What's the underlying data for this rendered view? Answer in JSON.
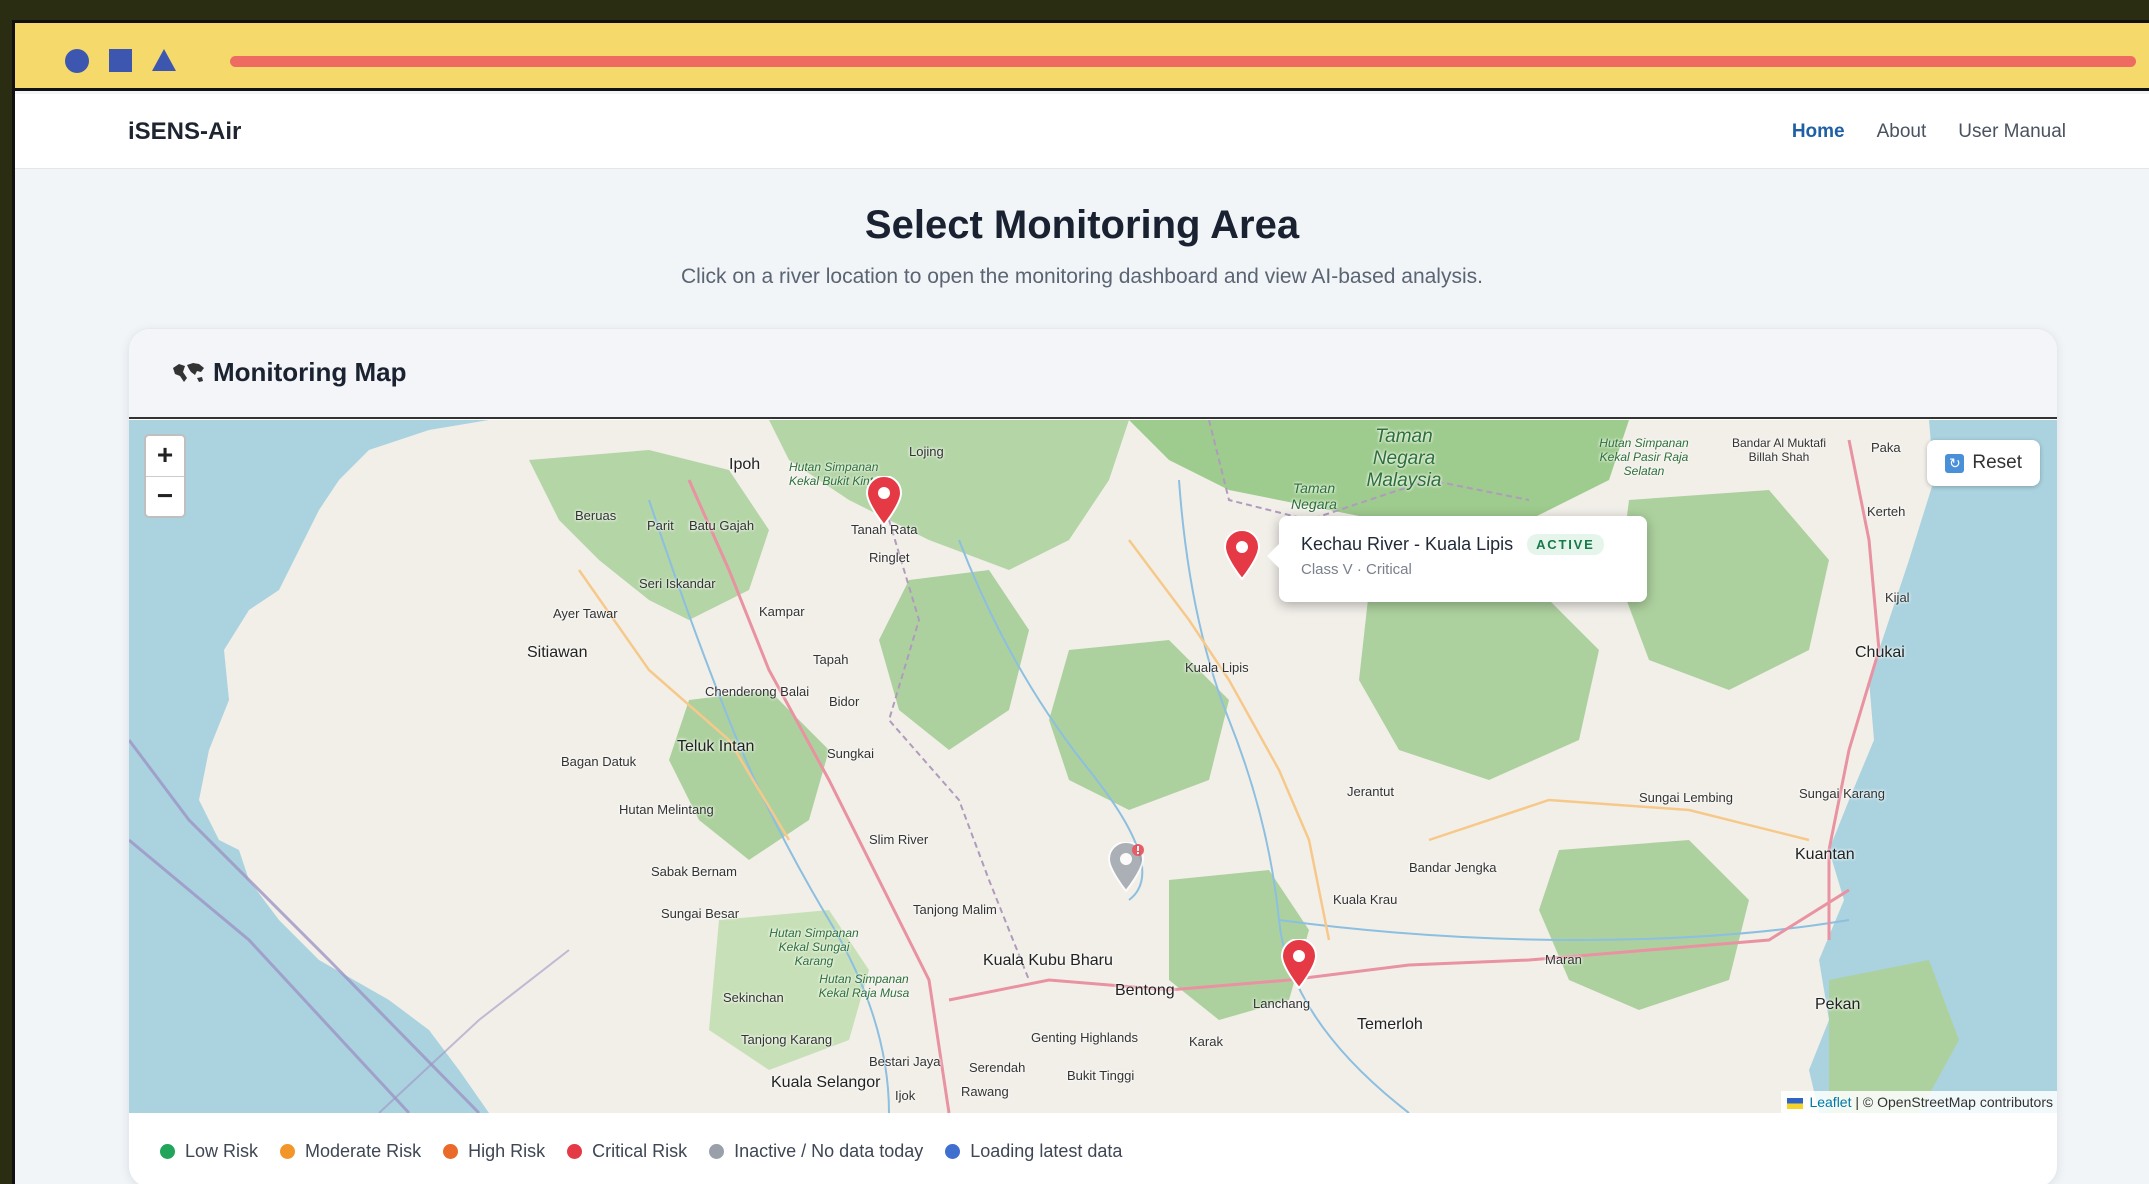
{
  "navbar": {
    "brand": "iSENS-Air",
    "links": [
      {
        "label": "Home",
        "active": true
      },
      {
        "label": "About",
        "active": false
      },
      {
        "label": "User Manual",
        "active": false
      }
    ]
  },
  "page": {
    "title": "Select Monitoring Area",
    "subtitle": "Click on a river location to open the monitoring dashboard and view AI-based analysis."
  },
  "card": {
    "title": "Monitoring Map",
    "icon": "world-map-icon"
  },
  "map": {
    "zoom_in": "+",
    "zoom_out": "−",
    "reset_label": "Reset",
    "popup": {
      "title": "Kechau River - Kuala Lipis",
      "badge": "ACTIVE",
      "subtitle": "Class V · Critical"
    },
    "attribution": {
      "leaflet": "Leaflet",
      "rest": "| © OpenStreetMap contributors"
    },
    "places": {
      "ipoh": "Ipoh",
      "lojing": "Lojing",
      "tanah_rata": "Tanah Rata",
      "ringlet": "Ringlet",
      "beruas": "Beruas",
      "parit": "Parit",
      "batu_gajah": "Batu Gajah",
      "seri_iskandar": "Seri Iskandar",
      "ayer_tawar": "Ayer Tawar",
      "kampar": "Kampar",
      "sitiawan": "Sitiawan",
      "tapah": "Tapah",
      "chenderong": "Chenderong Balai",
      "bidor": "Bidor",
      "teluk_intan": "Teluk Intan",
      "bagan_datuk": "Bagan Datuk",
      "sungkai": "Sungkai",
      "hutan_melintang": "Hutan Melintang",
      "slim_river": "Slim River",
      "sabak_bernam": "Sabak Bernam",
      "sungai_besar": "Sungai Besar",
      "tanjong_malim": "Tanjong Malim",
      "kuala_kubu": "Kuala Kubu Bharu",
      "sekinchan": "Sekinchan",
      "tanjong_karang": "Tanjong Karang",
      "bentong": "Bentong",
      "genting": "Genting Highlands",
      "bestari_jaya": "Bestari Jaya",
      "serendah": "Serendah",
      "kuala_selangor": "Kuala Selangor",
      "ijok": "Ijok",
      "rawang": "Rawang",
      "bukit_tinggi": "Bukit Tinggi",
      "karak": "Karak",
      "lanchang": "Lanchang",
      "temerloh": "Temerloh",
      "kuala_krau": "Kuala Krau",
      "bandar_jengka": "Bandar Jengka",
      "jerantut": "Jerantut",
      "kuala_lipis": "Kuala Lipis",
      "maran": "Maran",
      "kuantan": "Kuantan",
      "pekan": "Pekan",
      "sungai_lembing": "Sungai Lembing",
      "sungai_karang": "Sungai Karang",
      "chukai": "Chukai",
      "kijal": "Kijal",
      "kerteh": "Kerteh",
      "paka": "Paka",
      "bandar_al": "Bandar Al Muktafi Billah Shah",
      "taman_negara": "Taman Negara",
      "taman_negara_malaysia": "Taman Negara Malaysia",
      "hutan_kekal_bukit": "Hutan Simpanan Kekal Bukit Kinta",
      "hutan_kekal_pasir": "Hutan Simpanan Kekal Pasir Raja Selatan",
      "hutan_sungai": "Hutan Simpanan Kekal Sungai Karang",
      "hutan_raja": "Hutan Simpanan Kekal Raja Musa"
    }
  },
  "legend": [
    {
      "label": "Low Risk",
      "color": "#22a55a"
    },
    {
      "label": "Moderate Risk",
      "color": "#f3962a"
    },
    {
      "label": "High Risk",
      "color": "#ea6a2a"
    },
    {
      "label": "Critical Risk",
      "color": "#e53945"
    },
    {
      "label": "Inactive / No data today",
      "color": "#9aa0aa"
    },
    {
      "label": "Loading latest data",
      "color": "#3f6fcf"
    }
  ],
  "colors": {
    "brand_link": "#1f5fa6",
    "marker_critical": "#e53945",
    "marker_inactive": "#9aa0aa",
    "chrome_bar": "#f5da6b",
    "chrome_accent": "#3d57b0",
    "chrome_progress": "#ee6b62"
  }
}
